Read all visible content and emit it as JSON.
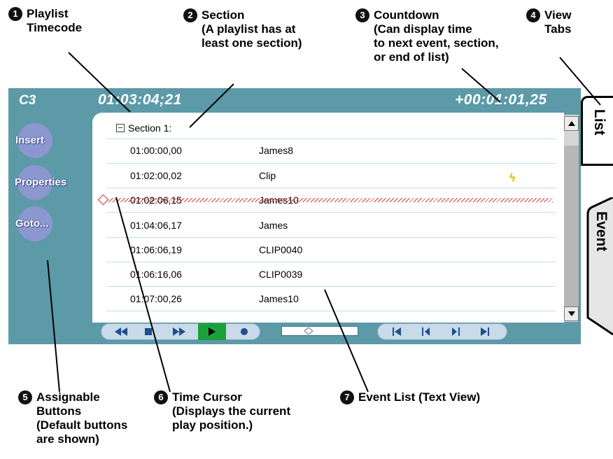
{
  "callouts": [
    {
      "n": "1",
      "text": "Playlist\nTimecode"
    },
    {
      "n": "2",
      "text": "Section\n(A playlist has at\nleast one section)"
    },
    {
      "n": "3",
      "text": "Countdown\n(Can display time\nto next event, section,\nor end of list)"
    },
    {
      "n": "4",
      "text": "View\nTabs"
    },
    {
      "n": "5",
      "text": "Assignable\nButtons\n(Default buttons\nare shown)"
    },
    {
      "n": "6",
      "text": "Time Cursor\n(Displays the current\nplay position.)"
    },
    {
      "n": "7",
      "text": "Event List (Text View)"
    }
  ],
  "header": {
    "channel": "C3",
    "timecode": "01:03:04;21",
    "countdown": "+00:01:01,25"
  },
  "buttons": [
    "Insert",
    "Properties",
    "Goto..."
  ],
  "section_label": "Section 1:",
  "events": [
    {
      "time": "01:00:00,00",
      "name": "James8"
    },
    {
      "time": "01:02:00,02",
      "name": "Clip"
    },
    {
      "time": "01:02:06,15",
      "name": "James10"
    },
    {
      "time": "01:04:06,17",
      "name": "James"
    },
    {
      "time": "01:06:06,19",
      "name": "CLIP0040"
    },
    {
      "time": "01:06:16,06",
      "name": "CLIP0039"
    },
    {
      "time": "01:07:00,26",
      "name": "James10"
    }
  ],
  "tabs": [
    "List",
    "Event"
  ],
  "colors": {
    "panel": "#5c9aa8",
    "cursor": "#e02b2b",
    "play": "#1aa13a"
  }
}
